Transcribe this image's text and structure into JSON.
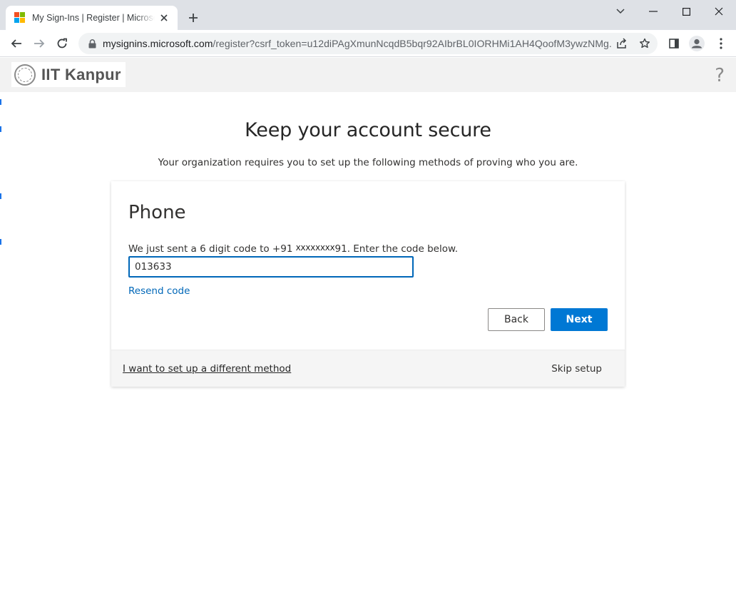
{
  "browser": {
    "tab_title": "My Sign-Ins | Register | Microsoft",
    "url_host": "mysignins.microsoft.com",
    "url_rest": "/register?csrf_token=u12diPAgXmunNcqdB5bqr92AIbrBL0IORHMi1AH4QoofM3ywzNMg...",
    "icons": [
      "back-icon",
      "forward-icon",
      "reload-icon",
      "lock-icon",
      "share-icon",
      "bookmark-star-icon",
      "side-panel-icon",
      "profile-icon",
      "menu-icon"
    ]
  },
  "banner": {
    "logo_text": "IIT Kanpur",
    "help_glyph": "?"
  },
  "main": {
    "heading": "Keep your account secure",
    "subheading": "Your organization requires you to set up the following methods of proving who you are."
  },
  "card": {
    "title": "Phone",
    "message_prefix": "We just sent a 6 digit code to +91 ",
    "message_redacted": "XXXXXXXX",
    "message_suffix": "91. Enter the code below.",
    "code_value": "013633",
    "resend_label": "Resend code",
    "back_label": "Back",
    "next_label": "Next",
    "different_method_label": "I want to set up a different method",
    "skip_label": "Skip setup"
  },
  "colors": {
    "accent": "#0078d4",
    "link": "#0067b8",
    "chrome_bg": "#dee1e6"
  }
}
